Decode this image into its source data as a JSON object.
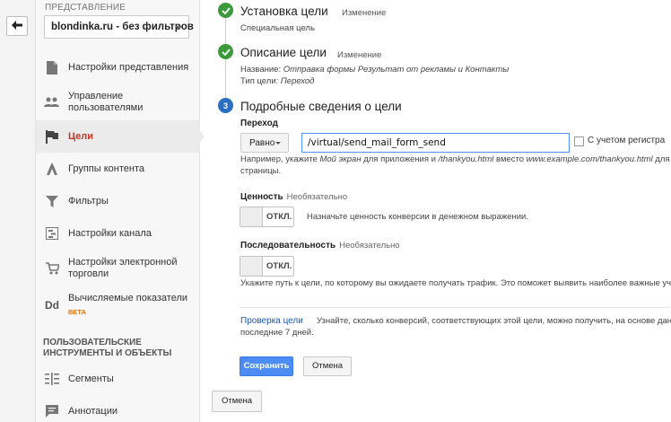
{
  "sidebar": {
    "section_label": "ПРЕДСТАВЛЕНИЕ",
    "view_select_value": "blondinka.ru - без фильтров",
    "items": [
      {
        "label": "Настройки представления",
        "icon": "document-icon"
      },
      {
        "label": "Управление пользователями",
        "icon": "users-icon"
      },
      {
        "label": "Цели",
        "icon": "flag-icon"
      },
      {
        "label": "Группы контента",
        "icon": "content-groups-icon"
      },
      {
        "label": "Фильтры",
        "icon": "filter-icon"
      },
      {
        "label": "Настройки канала",
        "icon": "channel-settings-icon"
      },
      {
        "label": "Настройки электронной торговли",
        "icon": "cart-icon"
      },
      {
        "label": "Вычисляемые показатели",
        "badge": "BETA",
        "icon": "dd-icon"
      },
      {
        "label": "Сегменты",
        "icon": "segments-icon"
      },
      {
        "label": "Аннотации",
        "icon": "annotation-icon"
      }
    ],
    "group_title": "ПОЛЬЗОВАТЕЛЬСКИЕ ИНСТРУМЕНТЫ И ОБЪЕКТЫ"
  },
  "step1": {
    "title": "Установка цели",
    "edit": "Изменение",
    "sub": "Специальная цель"
  },
  "step2": {
    "title": "Описание цели",
    "edit": "Изменение",
    "name_prefix": "Название: ",
    "name_value": "Отправка формы Результат от рекламы и Контакты",
    "type_prefix": "Тип цели: ",
    "type_value": "Переход"
  },
  "step3": {
    "number": "3",
    "title": "Подробные сведения о цели",
    "destination_label": "Переход",
    "match_type": "Равно",
    "destination_value": "/virtual/send_mail_form_send",
    "case_sensitive_label": "С учетом регистра",
    "hint_line1_a": "Например, укажите ",
    "hint_line1_b": "Мой экран",
    "hint_line1_c": " для приложения и ",
    "hint_line1_d": "/thankyou.html",
    "hint_line1_e": " вместо ",
    "hint_line1_f": "www.example.com/thankyou.html",
    "hint_line1_g": " для веб-",
    "hint_line2": "страницы.",
    "value_label": "Ценность",
    "value_optional": "Необязательно",
    "value_toggle": "ОТКЛ.",
    "value_hint": "Назначьте ценность конверсии в денежном выражении.",
    "funnel_label": "Последовательность",
    "funnel_optional": "Необязательно",
    "funnel_toggle": "ОТКЛ.",
    "funnel_hint": "Укажите путь к цели, по которому вы ожидаете получать трафик. Это поможет выявить наиболее важные участки.",
    "verify_link": "Проверка цели",
    "verify_text_line1": "Узнайте, сколько конверсий, соответствующих этой цели, можно получить, на основе данных за",
    "verify_text_line2": "последние 7 дней.",
    "save": "Сохранить",
    "cancel": "Отмена"
  },
  "footer_cancel": "Отмена",
  "colors": {
    "accent": "#4d8cf5",
    "done": "#3c9a3c",
    "active_nav": "#c53929",
    "link": "#1a57b5"
  }
}
